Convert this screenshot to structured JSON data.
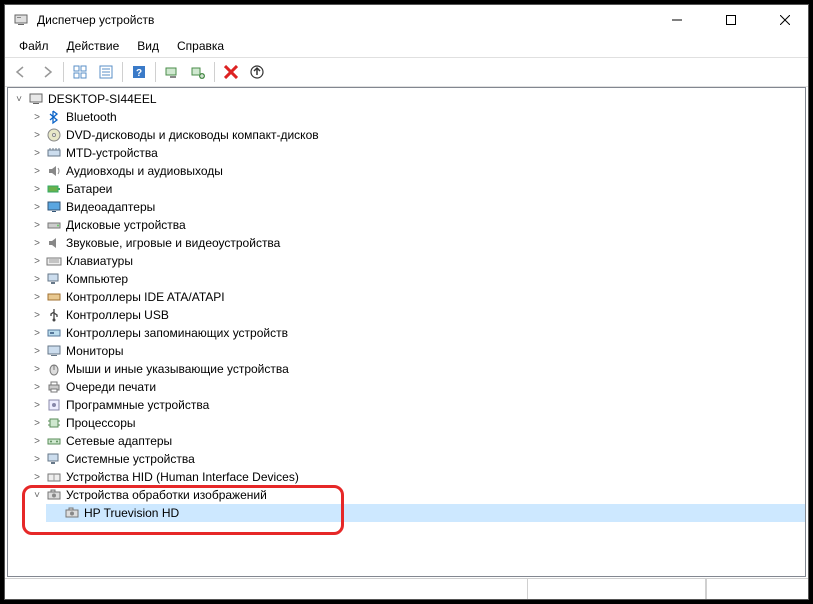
{
  "window": {
    "title": "Диспетчер устройств"
  },
  "menu": {
    "file": "Файл",
    "action": "Действие",
    "view": "Вид",
    "help": "Справка"
  },
  "tree": {
    "root": "DESKTOP-SI44EEL",
    "items": [
      "Bluetooth",
      "DVD-дисководы и дисководы компакт-дисков",
      "MTD-устройства",
      "Аудиовходы и аудиовыходы",
      "Батареи",
      "Видеоадаптеры",
      "Дисковые устройства",
      "Звуковые, игровые и видеоустройства",
      "Клавиатуры",
      "Компьютер",
      "Контроллеры IDE ATA/ATAPI",
      "Контроллеры USB",
      "Контроллеры запоминающих устройств",
      "Мониторы",
      "Мыши и иные указывающие устройства",
      "Очереди печати",
      "Программные устройства",
      "Процессоры",
      "Сетевые адаптеры",
      "Системные устройства",
      "Устройства HID (Human Interface Devices)",
      "Устройства обработки изображений"
    ],
    "imagingChild": "HP Truevision HD"
  }
}
